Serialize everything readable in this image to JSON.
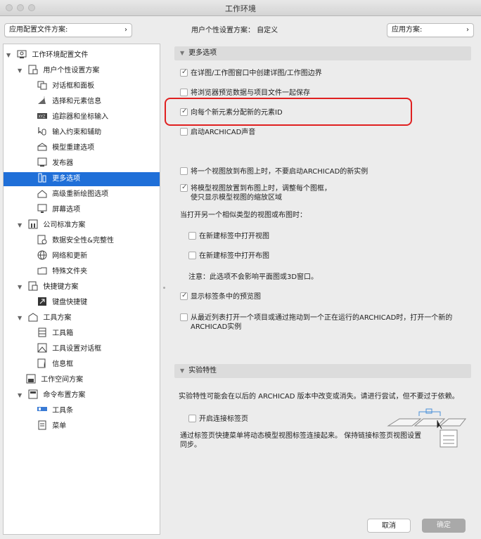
{
  "window": {
    "title": "工作环境"
  },
  "topbar": {
    "profile_scheme_label": "应用配置文件方案:",
    "user_scheme_text": "用户个性设置方案：  自定义",
    "apply_scheme_label": "应用方案:"
  },
  "tree": {
    "root": "工作环境配置文件",
    "user_prefs": "用户个性设置方案",
    "items_user": [
      "对话框和面板",
      "选择和元素信息",
      "追踪器和坐标输入",
      "输入约束和辅助",
      "模型重建选项",
      "发布器",
      "更多选项",
      "高级重新绘图选项",
      "屏幕选项"
    ],
    "company": "公司标准方案",
    "items_company": [
      "数据安全性&完整性",
      "网络和更新",
      "特殊文件夹"
    ],
    "shortcuts": "快捷键方案",
    "items_shortcuts": [
      "键盘快捷键"
    ],
    "tools": "工具方案",
    "items_tools": [
      "工具箱",
      "工具设置对话框",
      "信息框"
    ],
    "workspace": "工作空间方案",
    "commands": "命令布置方案",
    "items_commands": [
      "工具条",
      "菜单"
    ]
  },
  "more_options": {
    "header": "更多选项",
    "opt1": "在详图/工作图窗口中创建详图/工作图边界",
    "opt2": "将浏览器预览数据与项目文件一起保存",
    "opt3": "向每个新元素分配新的元素ID",
    "opt4": "启动ARCHICAD声音",
    "opt5": "将一个视图放到布图上时，不要启动ARCHICAD的新实例",
    "opt6_line1": "将模型视图放置到布图上时，调整每个图框，",
    "opt6_line2": "使只显示模型视图的缩放区域",
    "open_another": "当打开另一个相似类型的视图或布图时：",
    "opt7": "在新建标签中打开视图",
    "opt8": "在新建标签中打开布图",
    "note": "注意：此选项不会影响平面图或3D窗口。",
    "opt9": "显示标签条中的预览图",
    "opt10_line1": "从最近列表打开一个项目或通过拖动到一个正在运行的ARCHICAD时，打开一个新的",
    "opt10_line2": "ARCHICAD实例"
  },
  "experimental": {
    "header": "实验特性",
    "desc": "实验特性可能会在以后的 ARCHICAD 版本中改变或消失。请进行尝试，但不要过于依赖。",
    "opt_link": "开启连接标签页",
    "link_desc_line1": "通过标签页快捷菜单将动态模型视图标签连接起来。 保持链接标签页视图设置",
    "link_desc_line2": "同步。"
  },
  "footer": {
    "cancel": "取消",
    "ok": "确定"
  },
  "colors": {
    "selection": "#1f6fd8",
    "highlight": "#e02020"
  }
}
